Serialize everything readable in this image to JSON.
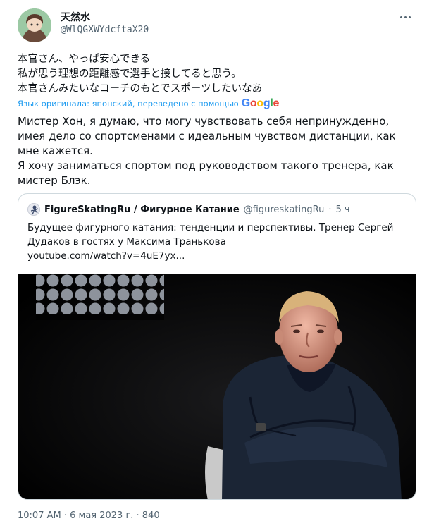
{
  "tweet": {
    "display_name": "天然水",
    "handle": "@WlQGXWYdcftaX20",
    "original_text": "本官さん、やっぱ安心できる\n私が思う理想の距離感で選手と接してると思う。\n本官さんみたいなコーチのもとでスポーツしたいなあ",
    "translation_notice": "Язык оригинала: японский, переведено с помощью",
    "translator": "Google",
    "translated_text": "Мистер Хон, я думаю, что могу чувствовать себя непринужденно, имея дело со спортсменами с идеальным чувством дистанции, как мне кажется.\nЯ хочу заниматься спортом под руководством такого тренера, как мистер Блэк."
  },
  "quote": {
    "name": "FigureSkatingRu / Фигурное Катание",
    "handle": "@figureskatingRu",
    "separator": "·",
    "time": "5 ч",
    "text": "Будущее фигурного катания: тенденции и перспективы. Тренер Сергей Дудаков в гостях у Максима Транькова\nyoutube.com/watch?v=4uE7yx..."
  },
  "footer": {
    "timestamp_partial": "10:07 AM · 6 мая 2023 г. · 840"
  },
  "colors": {
    "link": "#1d9bf0",
    "muted": "#536471",
    "border": "#cfd9de"
  },
  "icons": {
    "more": "more-icon",
    "quote_avatar": "figure-skater-icon"
  }
}
